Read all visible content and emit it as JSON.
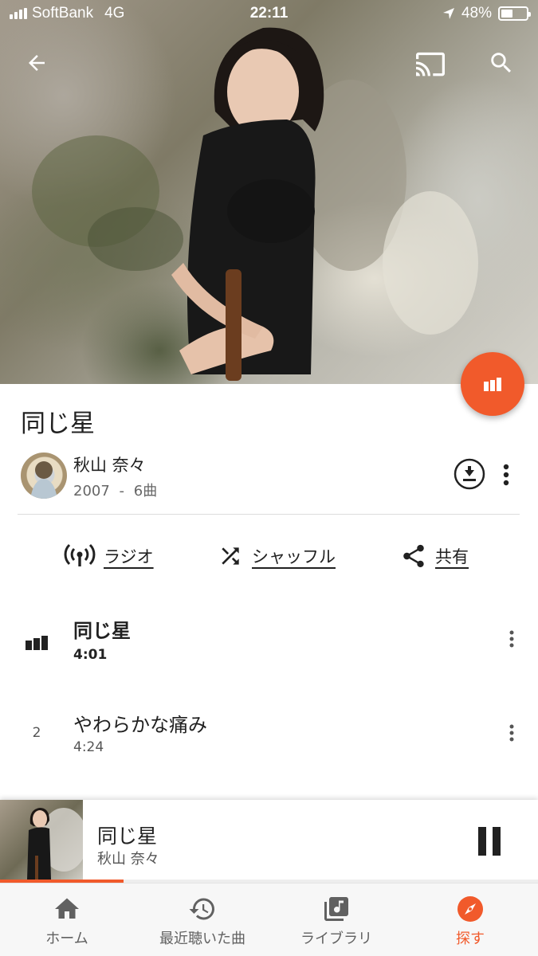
{
  "status_bar": {
    "carrier": "SoftBank",
    "network": "4G",
    "time": "22:11",
    "battery": "48%",
    "battery_level": 0.48
  },
  "toolbar": {
    "back_icon": "arrow-left-icon",
    "cast_icon": "cast-icon",
    "search_icon": "search-icon"
  },
  "album": {
    "title": "同じ星",
    "artist": "秋山 奈々",
    "year": "2007",
    "separator": "-",
    "track_count": "6曲"
  },
  "actions": [
    {
      "label": "ラジオ",
      "icon": "radio-icon"
    },
    {
      "label": "シャッフル",
      "icon": "shuffle-icon"
    },
    {
      "label": "共有",
      "icon": "share-icon"
    }
  ],
  "tracks": [
    {
      "number": "",
      "title": "同じ星",
      "duration": "4:01",
      "playing": true
    },
    {
      "number": "2",
      "title": "やわらかな痛み",
      "duration": "4:24",
      "playing": false
    }
  ],
  "now_playing": {
    "title": "同じ星",
    "artist": "秋山 奈々",
    "progress": 0.23
  },
  "bottom_nav": [
    {
      "label": "ホーム",
      "icon": "home-icon",
      "active": false
    },
    {
      "label": "最近聴いた曲",
      "icon": "history-icon",
      "active": false
    },
    {
      "label": "ライブラリ",
      "icon": "library-icon",
      "active": false
    },
    {
      "label": "探す",
      "icon": "explore-icon",
      "active": true
    }
  ],
  "colors": {
    "accent": "#f15a2b",
    "text_primary": "#212121",
    "text_secondary": "#666666"
  }
}
